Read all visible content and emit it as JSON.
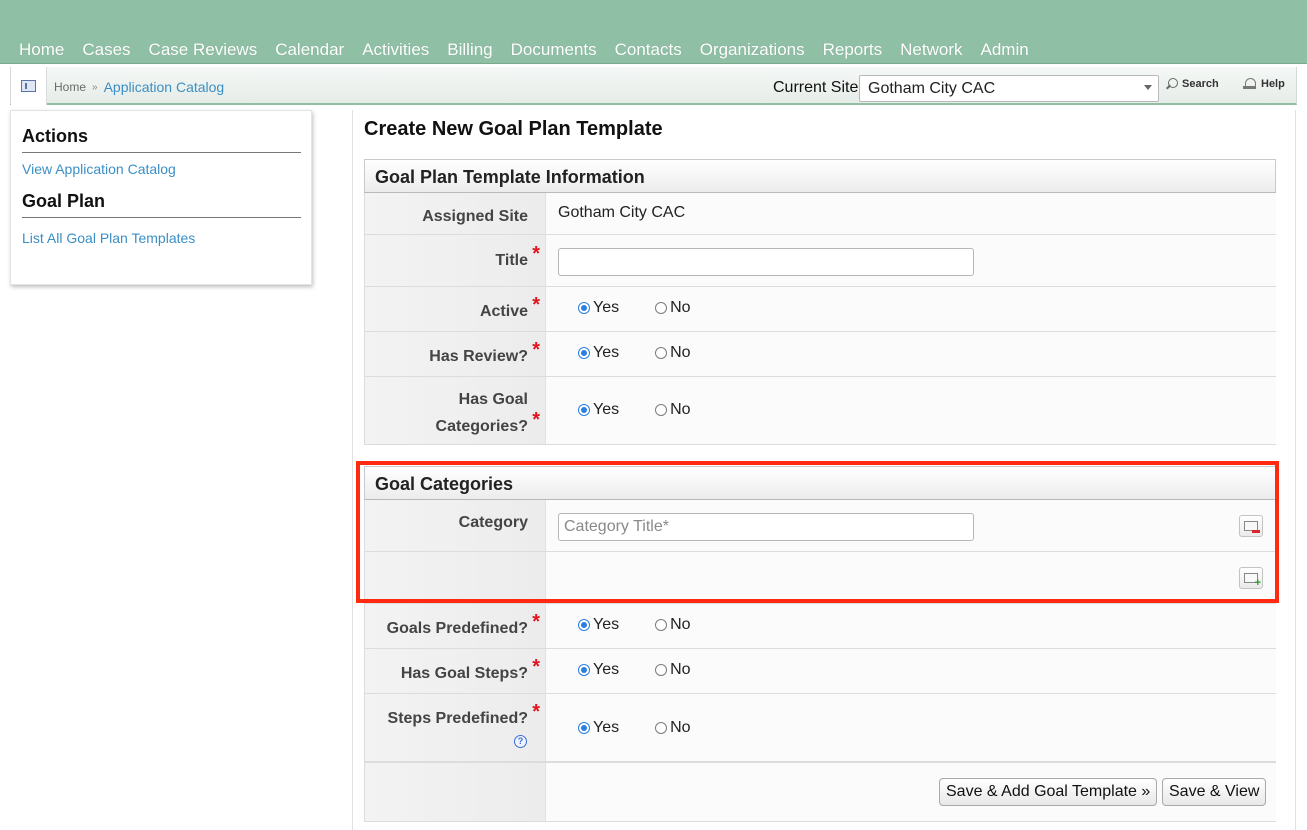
{
  "nav": {
    "items": [
      "Home",
      "Cases",
      "Case Reviews",
      "Calendar",
      "Activities",
      "Billing",
      "Documents",
      "Contacts",
      "Organizations",
      "Reports",
      "Network",
      "Admin"
    ]
  },
  "subbar": {
    "breadcrumb_home": "Home",
    "breadcrumb_sep": "»",
    "breadcrumb_current": "Application Catalog",
    "current_site_label": "Current Site",
    "current_site_value": "Gotham City CAC",
    "search_label": "Search",
    "help_label": "Help"
  },
  "sidebar": {
    "actions_title": "Actions",
    "actions_link": "View Application Catalog",
    "goal_plan_title": "Goal Plan",
    "goal_plan_link": "List All Goal Plan Templates"
  },
  "main": {
    "page_title": "Create New Goal Plan Template",
    "info_section_title": "Goal Plan Template Information",
    "assigned_site_label": "Assigned Site",
    "assigned_site_value": "Gotham City CAC",
    "title_label": "Title",
    "title_value": "",
    "active_label": "Active",
    "has_review_label": "Has Review?",
    "has_goal_categories_label_1": "Has Goal",
    "has_goal_categories_label_2": "Categories?",
    "required_mark": "*",
    "yes": "Yes",
    "no": "No",
    "goal_categories_title": "Goal Categories",
    "category_label": "Category",
    "category_placeholder": "Category Title*",
    "goals_predefined_label": "Goals Predefined?",
    "has_goal_steps_label": "Has Goal Steps?",
    "steps_predefined_label": "Steps Predefined?",
    "help_q": "?",
    "save_add_button": "Save & Add Goal Template »",
    "save_view_button": "Save & View"
  },
  "colors": {
    "nav_bg": "#8fbfa4",
    "link": "#3b8fc4",
    "required": "#e0141e",
    "highlight": "#ff2a0f",
    "radio_selected": "#2b7fe0"
  }
}
